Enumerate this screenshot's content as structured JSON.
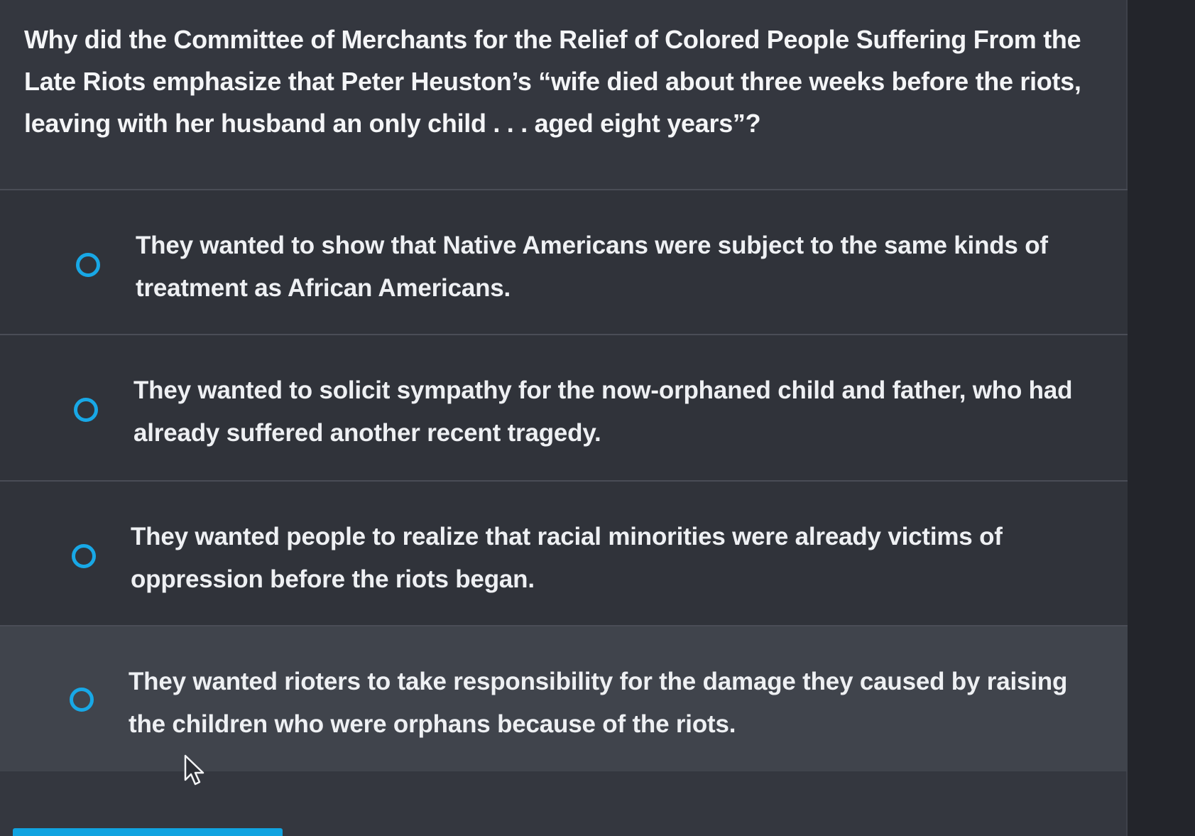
{
  "question": {
    "text": "Why did the Committee of Merchants for the Relief of Colored People Suffering From the Late Riots emphasize that Peter Heuston’s “wife died about three weeks before the riots, leaving with her husband an only child . . . aged eight years”?"
  },
  "options": [
    {
      "label": "They wanted to show that Native Americans were subject to the same kinds of treatment as African Americans."
    },
    {
      "label": "They wanted to solicit sympathy for the now-orphaned child and father, who had already suffered another recent tragedy."
    },
    {
      "label": "They wanted people to realize that racial minorities were already victims of oppression before the riots began."
    },
    {
      "label": "They wanted rioters to take responsibility for the damage they caused by raising the children who were orphans because of the riots."
    }
  ],
  "icons": {
    "radio": "radio-unselected-icon",
    "cursor": "mouse-pointer-icon"
  },
  "colors": {
    "accent": "#18a8e6",
    "background": "#34373f",
    "hover_option": "#40444c",
    "text": "#f1f2f4"
  }
}
